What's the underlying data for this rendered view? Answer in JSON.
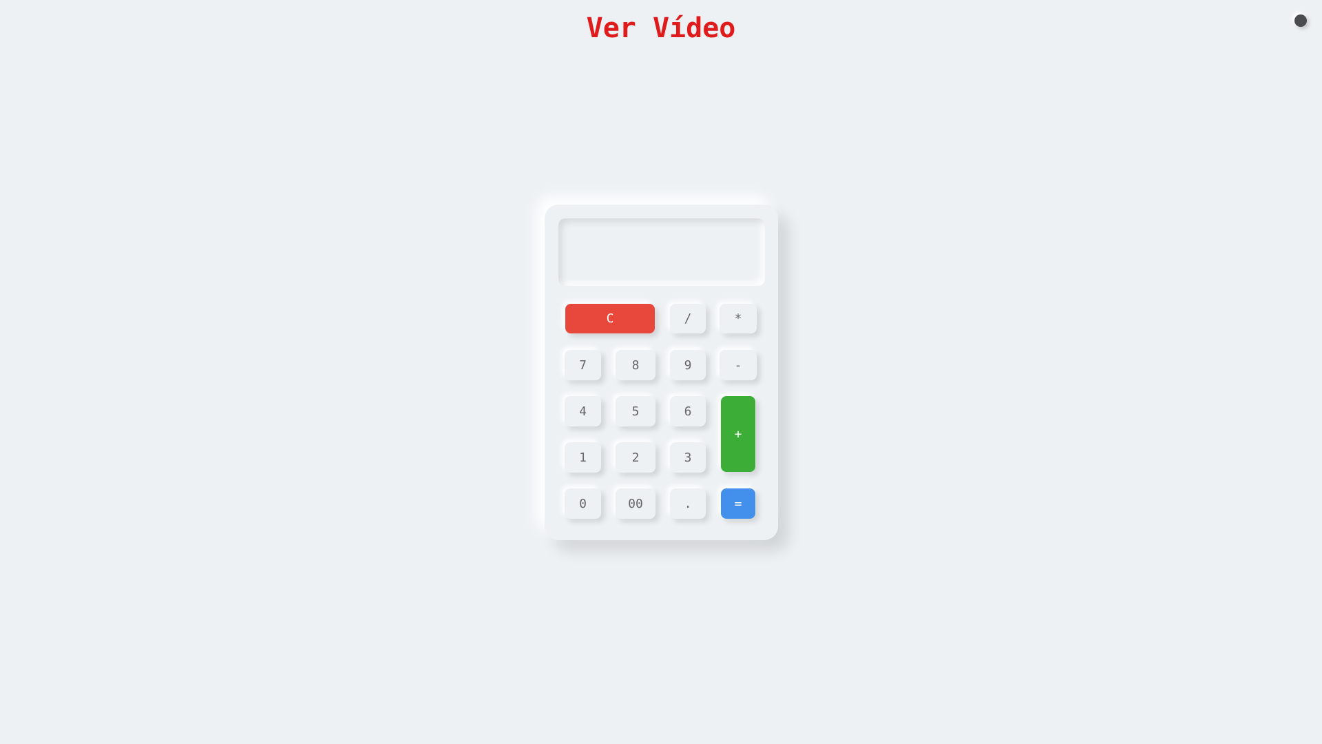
{
  "header": {
    "title": "Ver Vídeo"
  },
  "colors": {
    "background": "#edf1f4",
    "title": "#e01b1b",
    "clear_key": "#e8483b",
    "plus_key": "#3cae37",
    "equal_key": "#4390ec",
    "theme_toggle": "#4a4c50"
  },
  "theme_toggle": {
    "icon": "dot-icon"
  },
  "calculator": {
    "display": {
      "value": "",
      "placeholder": ""
    },
    "keys": [
      {
        "label": "C"
      },
      {
        "label": "/"
      },
      {
        "label": "*"
      },
      {
        "label": "7"
      },
      {
        "label": "8"
      },
      {
        "label": "9"
      },
      {
        "label": "-"
      },
      {
        "label": "4"
      },
      {
        "label": "5"
      },
      {
        "label": "6"
      },
      {
        "label": "+"
      },
      {
        "label": "1"
      },
      {
        "label": "2"
      },
      {
        "label": "3"
      },
      {
        "label": "0"
      },
      {
        "label": "00"
      },
      {
        "label": "."
      },
      {
        "label": "="
      }
    ]
  }
}
